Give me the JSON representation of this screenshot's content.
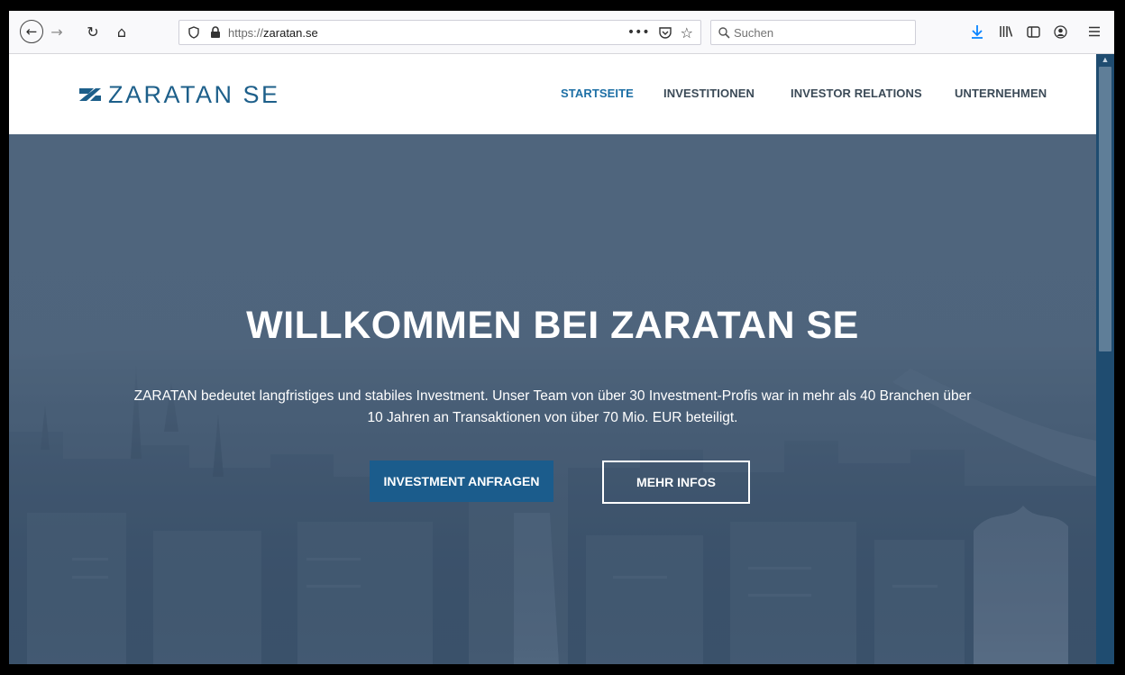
{
  "browser": {
    "url_protocol": "https://",
    "url_domain": "zaratan.se",
    "search_placeholder": "Suchen",
    "icons": [
      "back-icon",
      "forward-icon",
      "reload-icon",
      "home-icon",
      "tracking-protection-icon",
      "lock-icon",
      "page-actions-icon",
      "pocket-icon",
      "bookmark-star-icon",
      "search-icon",
      "download-icon",
      "library-icon",
      "sidebar-icon",
      "account-icon",
      "menu-icon"
    ],
    "accent_color": "#0a84ff"
  },
  "site": {
    "logo_text": "ZARATAN SE",
    "brand_color": "#1d5f8a",
    "nav": {
      "home": "STARTSEITE",
      "investments": "INVESTITIONEN",
      "investor_relations": "INVESTOR RELATIONS",
      "company": "UNTERNEHMEN"
    },
    "hero": {
      "title": "WILLKOMMEN BEI ZARATAN SE",
      "text_line1": "ZARATAN bedeutet langfristiges und stabiles Investment. Unser Team von über 30 Investment-Profis war in mehr als 40 Branchen über",
      "text_line2": "10 Jahren an Transaktionen von über 70 Mio. EUR beteiligt.",
      "primary_button": "INVESTMENT ANFRAGEN",
      "secondary_button": "MEHR INFOS"
    }
  }
}
